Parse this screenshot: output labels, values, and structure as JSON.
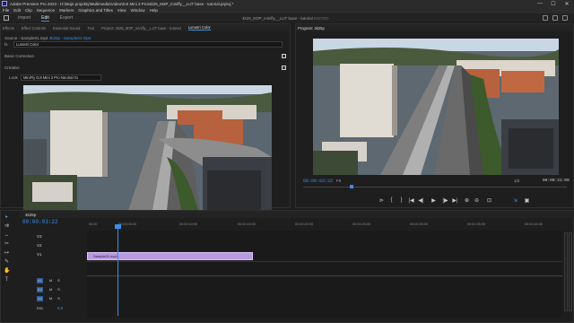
{
  "window": {
    "title": "Adobe Premiere Pro 2023 - H:\\Moje projekty\\Multimedia\\Video\\DJI Mini 3 Pro\\4k25_M3P_minifly__LUT base - tutorial.prproj *",
    "min": "—",
    "max": "☐",
    "close": "✕"
  },
  "menu": [
    "File",
    "Edit",
    "Clip",
    "Sequence",
    "Markers",
    "Graphics and Titles",
    "View",
    "Window",
    "Help"
  ],
  "workspace": {
    "modes": [
      "Import",
      "Edit",
      "Export"
    ],
    "active": "Edit",
    "center": "4k25_M3P_minifly__LUT base - tutorial",
    "center_badge": "EDITED"
  },
  "source_panel": {
    "tabs": [
      "Effects",
      "Effect Controls",
      "Essential Sound",
      "Text",
      "Project: 4k25_M3P_minifly__LUT base - tutorial",
      "Lumetri Color"
    ],
    "active_tab": "Lumetri Color",
    "breadcrumb_source": "Source - Sample01.mp4",
    "breadcrumb_seq": "4k25p - Sample01.mp4",
    "fx_label": "fx",
    "effect_name": "Lumetri Color",
    "basic_correction": "Basic Correction",
    "creative": "Creative",
    "look_label": "Look",
    "look_value": "MiniFly DJI Mini 3 Pro Neutral 01"
  },
  "program": {
    "title": "Program: 4k25p",
    "timecode": "00:00:03:22",
    "fit": "Fit",
    "ratio": "1/2",
    "duration": "00:00:21:00"
  },
  "controls": [
    "⊳",
    "{",
    "}",
    "|◀",
    "◀|",
    "▶",
    "|▶",
    "▶|",
    "⊕",
    "⊖",
    "⊡",
    "⇲",
    "▣"
  ],
  "timeline": {
    "tab": "4k25p",
    "timecode": "00:00:03:22",
    "ruler": [
      "00:00",
      "00:00:05:00",
      "00:00:10:00",
      "00:00:15:00",
      "00:00:20:00",
      "00:00:25:00",
      "00:00:30:00",
      "00:00:35:00",
      "00:00:40:00",
      "00:00:45:00"
    ],
    "clip_name": "Sample01.mp4",
    "mix_label": "Mix",
    "mix_value": "0.0"
  },
  "tracks": [
    {
      "name": "V3"
    },
    {
      "name": "V2"
    },
    {
      "name": "V1"
    },
    {
      "name": "A1"
    },
    {
      "name": "A2"
    },
    {
      "name": "A3"
    }
  ],
  "track_buttons": {
    "m": "M",
    "s": "S"
  },
  "tools": [
    "▸",
    "⇉",
    "↔",
    "✂",
    "↦",
    "✎",
    "✋",
    "T"
  ],
  "colors": {
    "accent": "#3d8ee8",
    "clip": "#b89ae0",
    "sky": "#c9d6e3"
  },
  "icons": [
    "home-icon",
    "menu-icon",
    "play-icon",
    "stop-icon",
    "wrench-icon",
    "scissors-icon"
  ]
}
